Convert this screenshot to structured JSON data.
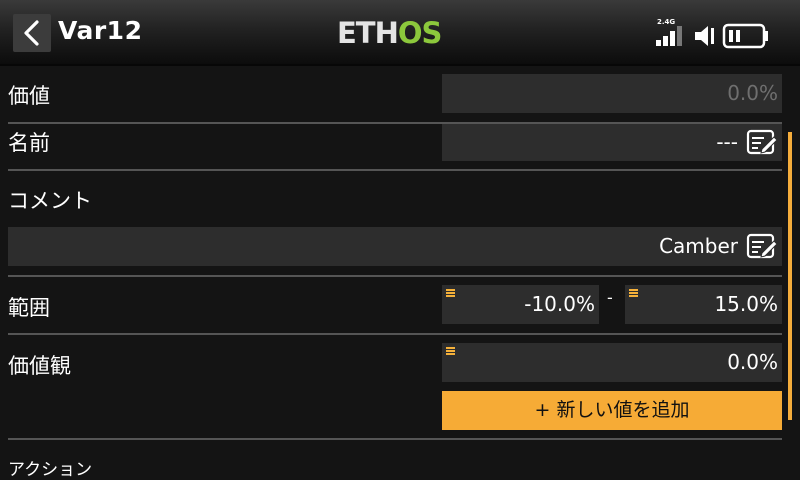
{
  "header": {
    "back_icon": "chevron-left-icon",
    "title": "Var12",
    "logo_text_white": "ETH",
    "logo_text_green": "OS",
    "logo_color_green": "#8cc83c",
    "radio_band": "2.4G",
    "icons": [
      "signal-icon",
      "speaker-icon",
      "battery-icon"
    ]
  },
  "rows": {
    "value": {
      "label": "価値",
      "field": "0.0%"
    },
    "name": {
      "label": "名前",
      "field": "---",
      "icon": "edit-icon"
    },
    "comment": {
      "label": "コメント",
      "field": "Camber",
      "icon": "edit-icon"
    },
    "range": {
      "label": "範囲",
      "min": "-10.0%",
      "separator": "-",
      "max": "15.0%"
    },
    "values": {
      "label": "価値観",
      "field": "0.0%",
      "add_button": "+ 新しい値を追加"
    },
    "actions": {
      "label": "アクション"
    }
  },
  "colors": {
    "accent": "#f6ab36",
    "field_bg": "#2d2d2d",
    "background": "#141414"
  }
}
